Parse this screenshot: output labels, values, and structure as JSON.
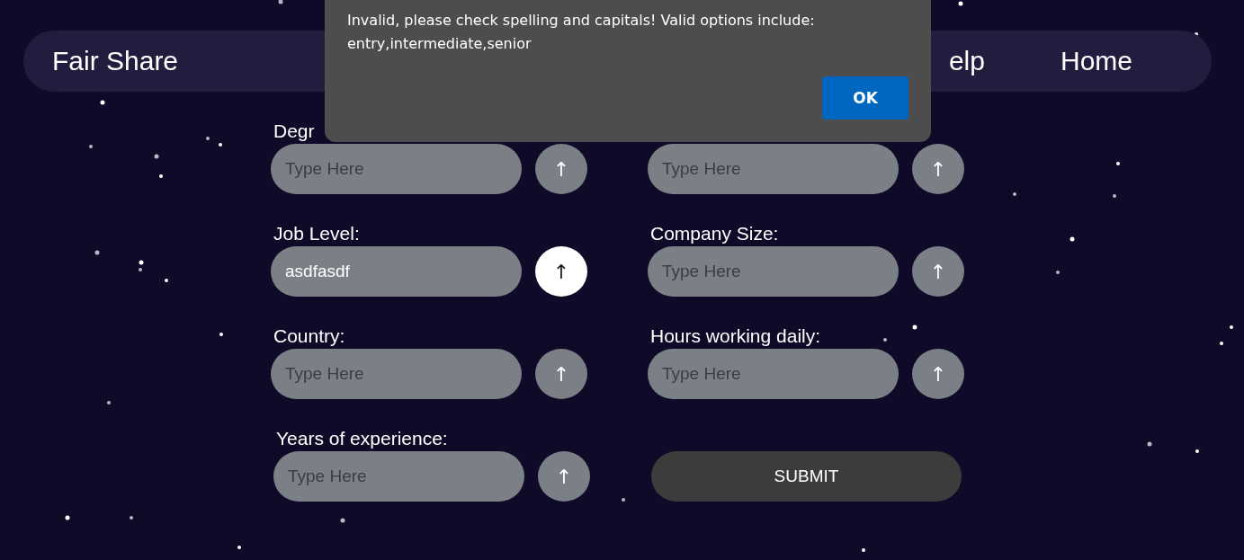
{
  "nav": {
    "brand": "Fair Share",
    "links": [
      {
        "label": "elp"
      },
      {
        "label": "Home"
      }
    ]
  },
  "form": {
    "fields": [
      {
        "label": "Degr",
        "placeholder": "Type Here",
        "button": "↑",
        "button_active": false
      },
      {
        "placeholder": "Type Here",
        "button": "↑",
        "button_active": false
      },
      {
        "label": "Job Level:",
        "value": "asdfasdf",
        "button": "↑",
        "button_active": true
      },
      {
        "label": "Company Size:",
        "placeholder": "Type Here",
        "button": "↑",
        "button_active": false
      },
      {
        "label": "Country:",
        "placeholder": "Type Here",
        "button": "↑",
        "button_active": false
      },
      {
        "label": "Hours working daily:",
        "placeholder": "Type Here",
        "button": "↑",
        "button_active": false
      },
      {
        "label": "Years of experience:",
        "placeholder": "Type Here",
        "button": "↑",
        "button_active": false
      }
    ],
    "submit": "SUBMIT"
  },
  "dialog": {
    "message": "Invalid, please check spelling and capitals! Valid options include: entry,intermediate,senior",
    "button": "OK"
  }
}
